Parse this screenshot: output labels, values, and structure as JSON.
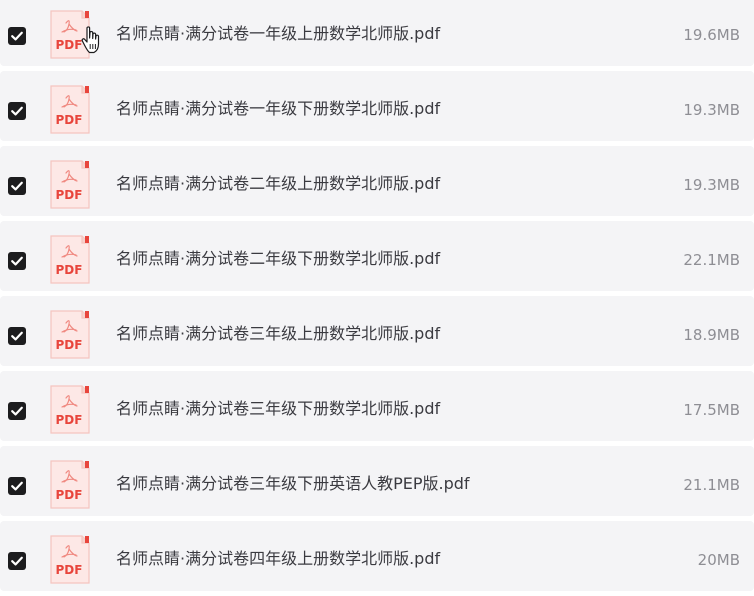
{
  "accent": "#1c1c1e",
  "pdf_icon_color": "#e8453c",
  "files": [
    {
      "name": "名师点睛·满分试卷一年级上册数学北师版.pdf",
      "size": "19.6MB",
      "checked": true,
      "icon": "pdf-file-icon",
      "icon_label": "PDF"
    },
    {
      "name": "名师点睛·满分试卷一年级下册数学北师版.pdf",
      "size": "19.3MB",
      "checked": true,
      "icon": "pdf-file-icon",
      "icon_label": "PDF"
    },
    {
      "name": "名师点睛·满分试卷二年级上册数学北师版.pdf",
      "size": "19.3MB",
      "checked": true,
      "icon": "pdf-file-icon",
      "icon_label": "PDF"
    },
    {
      "name": "名师点睛·满分试卷二年级下册数学北师版.pdf",
      "size": "22.1MB",
      "checked": true,
      "icon": "pdf-file-icon",
      "icon_label": "PDF"
    },
    {
      "name": "名师点睛·满分试卷三年级上册数学北师版.pdf",
      "size": "18.9MB",
      "checked": true,
      "icon": "pdf-file-icon",
      "icon_label": "PDF"
    },
    {
      "name": "名师点睛·满分试卷三年级下册数学北师版.pdf",
      "size": "17.5MB",
      "checked": true,
      "icon": "pdf-file-icon",
      "icon_label": "PDF"
    },
    {
      "name": "名师点睛·满分试卷三年级下册英语人教PEP版.pdf",
      "size": "21.1MB",
      "checked": true,
      "icon": "pdf-file-icon",
      "icon_label": "PDF"
    },
    {
      "name": "名师点睛·满分试卷四年级上册数学北师版.pdf",
      "size": "20MB",
      "checked": true,
      "icon": "pdf-file-icon",
      "icon_label": "PDF"
    }
  ],
  "cursor_icon": "hand-pointer-icon"
}
